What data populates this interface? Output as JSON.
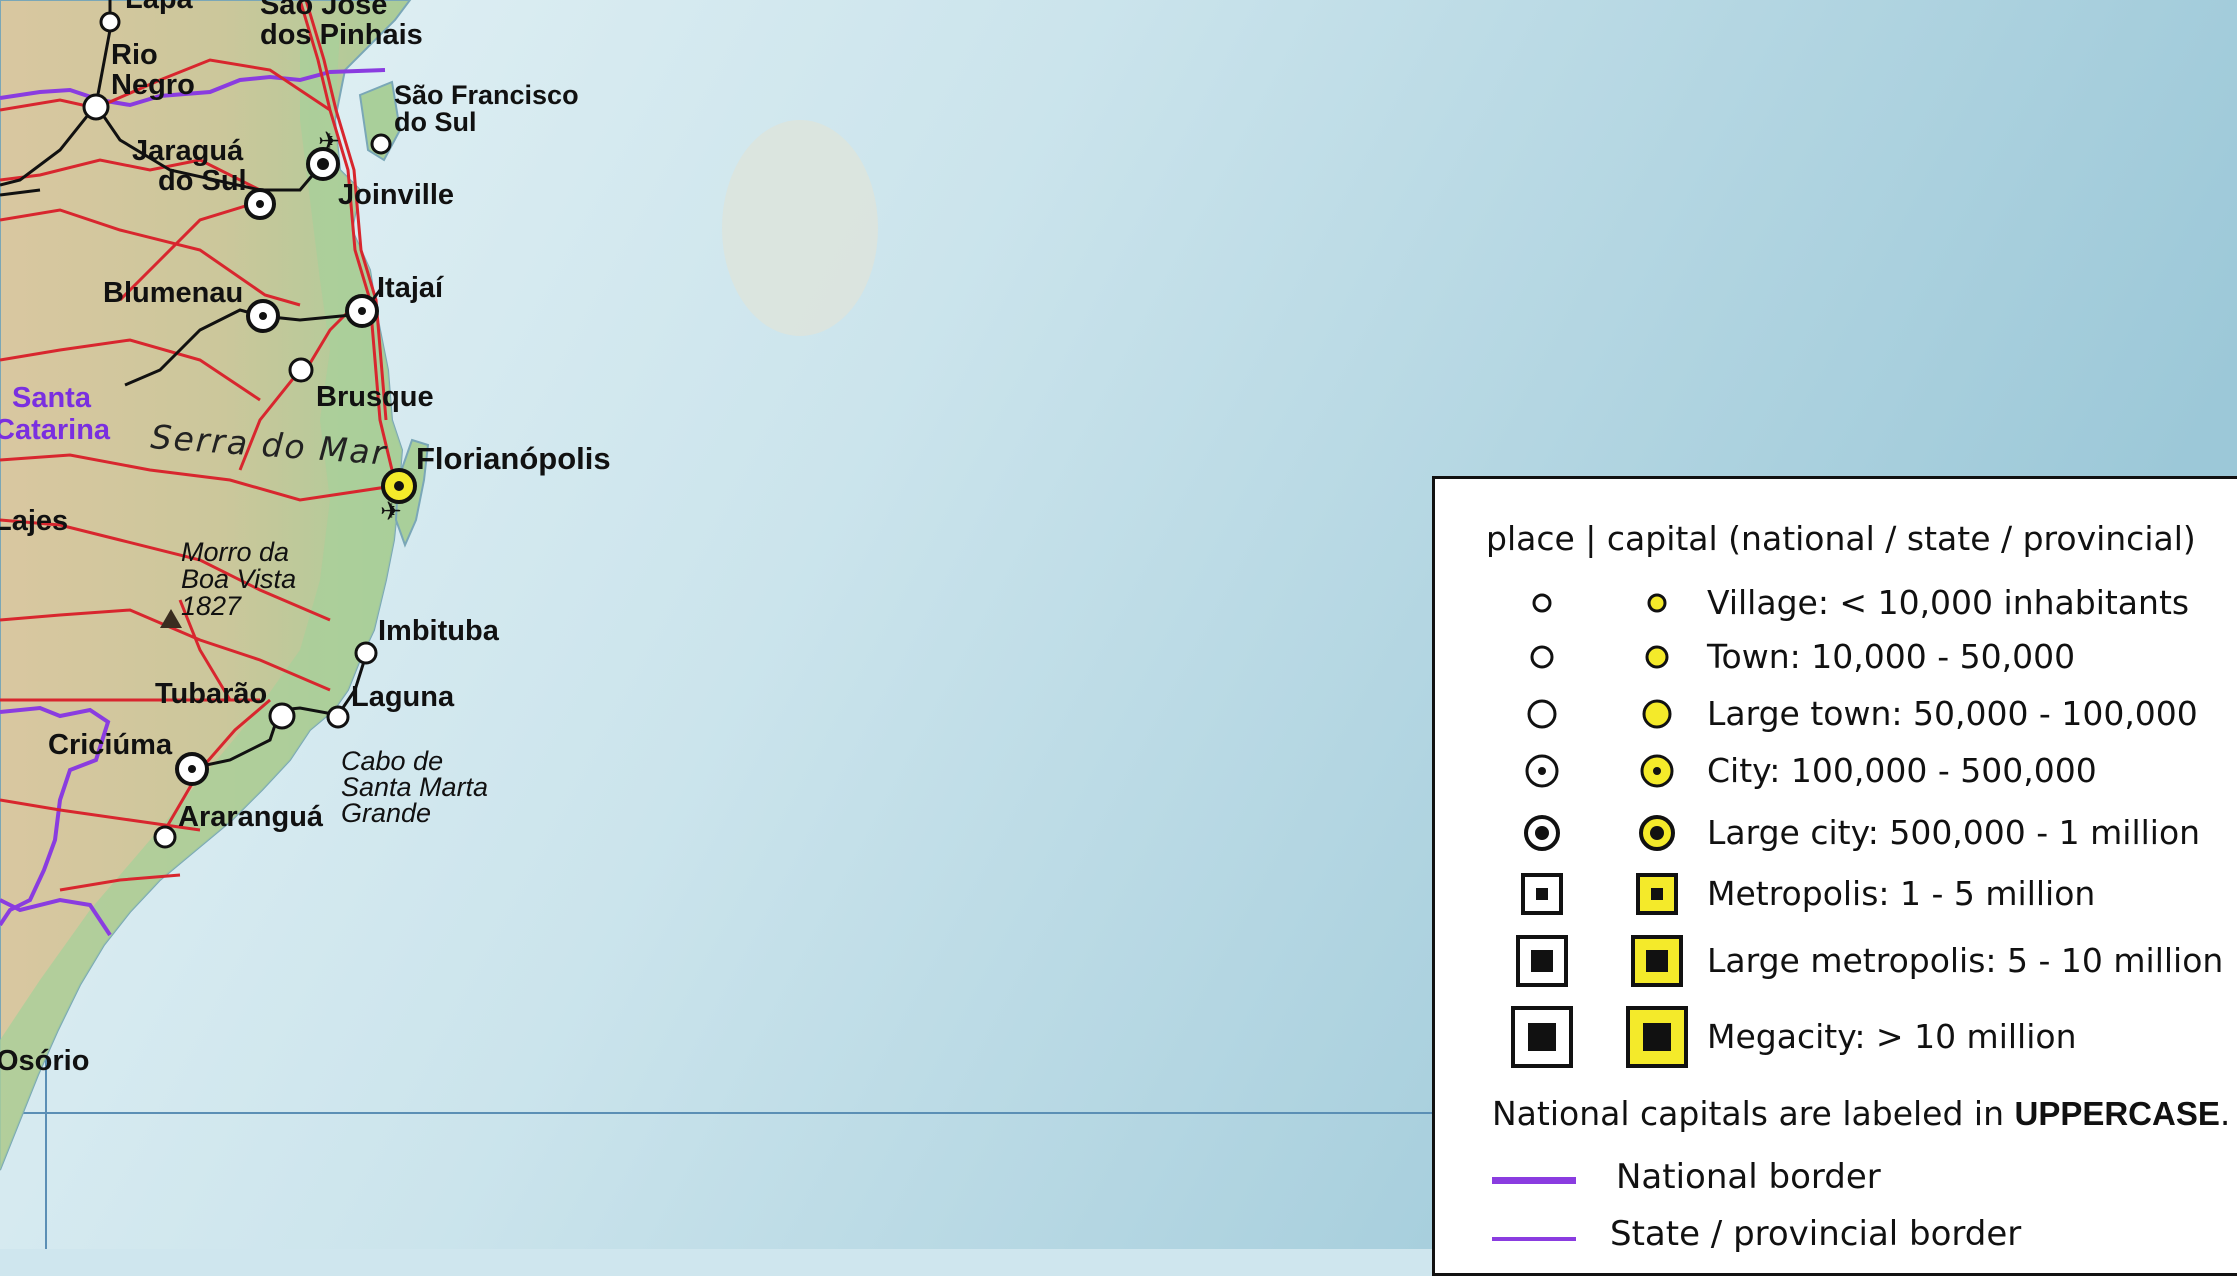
{
  "map": {
    "colors": {
      "ocean": "#cfe6ee",
      "land": "#d8c9a2",
      "lowland": "#b9d1a4",
      "road": "#d8262e",
      "rail": "#111111",
      "national_border": "#8a3ce0",
      "capital_fill": "#f4ea2a"
    },
    "labels": {
      "lapa": "Lapa",
      "sao_jose_1": "São José",
      "sao_jose_2": "dos Pinhais",
      "rio_negro_1": "Rio",
      "rio_negro_2": "Negro",
      "sao_francisco_1": "São Francisco",
      "sao_francisco_2": "do Sul",
      "jaragua_1": "Jaraguá",
      "jaragua_2": "do Sul",
      "joinville": "Joinville",
      "blumenau": "Blumenau",
      "itajai": "Itajaí",
      "brusque": "Brusque",
      "santa_catarina_1": "Santa",
      "santa_catarina_2": "Catarina",
      "serra_do_mar": "Serra do Mar",
      "florianopolis": "Florianópolis",
      "lajes": "Lajes",
      "morro_1": "Morro da",
      "morro_2": "Boa Vista",
      "morro_3": "1827",
      "imbituba": "Imbituba",
      "tubarao": "Tubarão",
      "laguna": "Laguna",
      "criciuma": "Criciúma",
      "cabo_1": "Cabo de",
      "cabo_2": "Santa Marta",
      "cabo_3": "Grande",
      "ararangua": "Araranguá",
      "osorio": "Osório"
    }
  },
  "legend": {
    "header": "place | capital (national / state / provincial)",
    "rows": [
      {
        "symbol": "village-circle",
        "label": "Village: < 10,000 inhabitants"
      },
      {
        "symbol": "town-circle",
        "label": "Town: 10,000 - 50,000"
      },
      {
        "symbol": "large-town-circle",
        "label": "Large town: 50,000 - 100,000"
      },
      {
        "symbol": "city-dotted-circle",
        "label": "City: 100,000 - 500,000"
      },
      {
        "symbol": "large-city-dotted-circle",
        "label": "Large city: 500,000 - 1 million"
      },
      {
        "symbol": "metropolis-square",
        "label": "Metropolis: 1 - 5 million"
      },
      {
        "symbol": "large-metropolis-square",
        "label": "Large metropolis: 5 - 10 million"
      },
      {
        "symbol": "megacity-square",
        "label": "Megacity: > 10 million"
      }
    ],
    "note_prefix": "National capitals are labeled in ",
    "note_bold": "UPPERCASE",
    "note_suffix": ".",
    "lines": [
      {
        "label": "National border",
        "color": "#8a3ce0"
      },
      {
        "label": "State / provincial border",
        "color": "#8a3ce0"
      }
    ]
  }
}
